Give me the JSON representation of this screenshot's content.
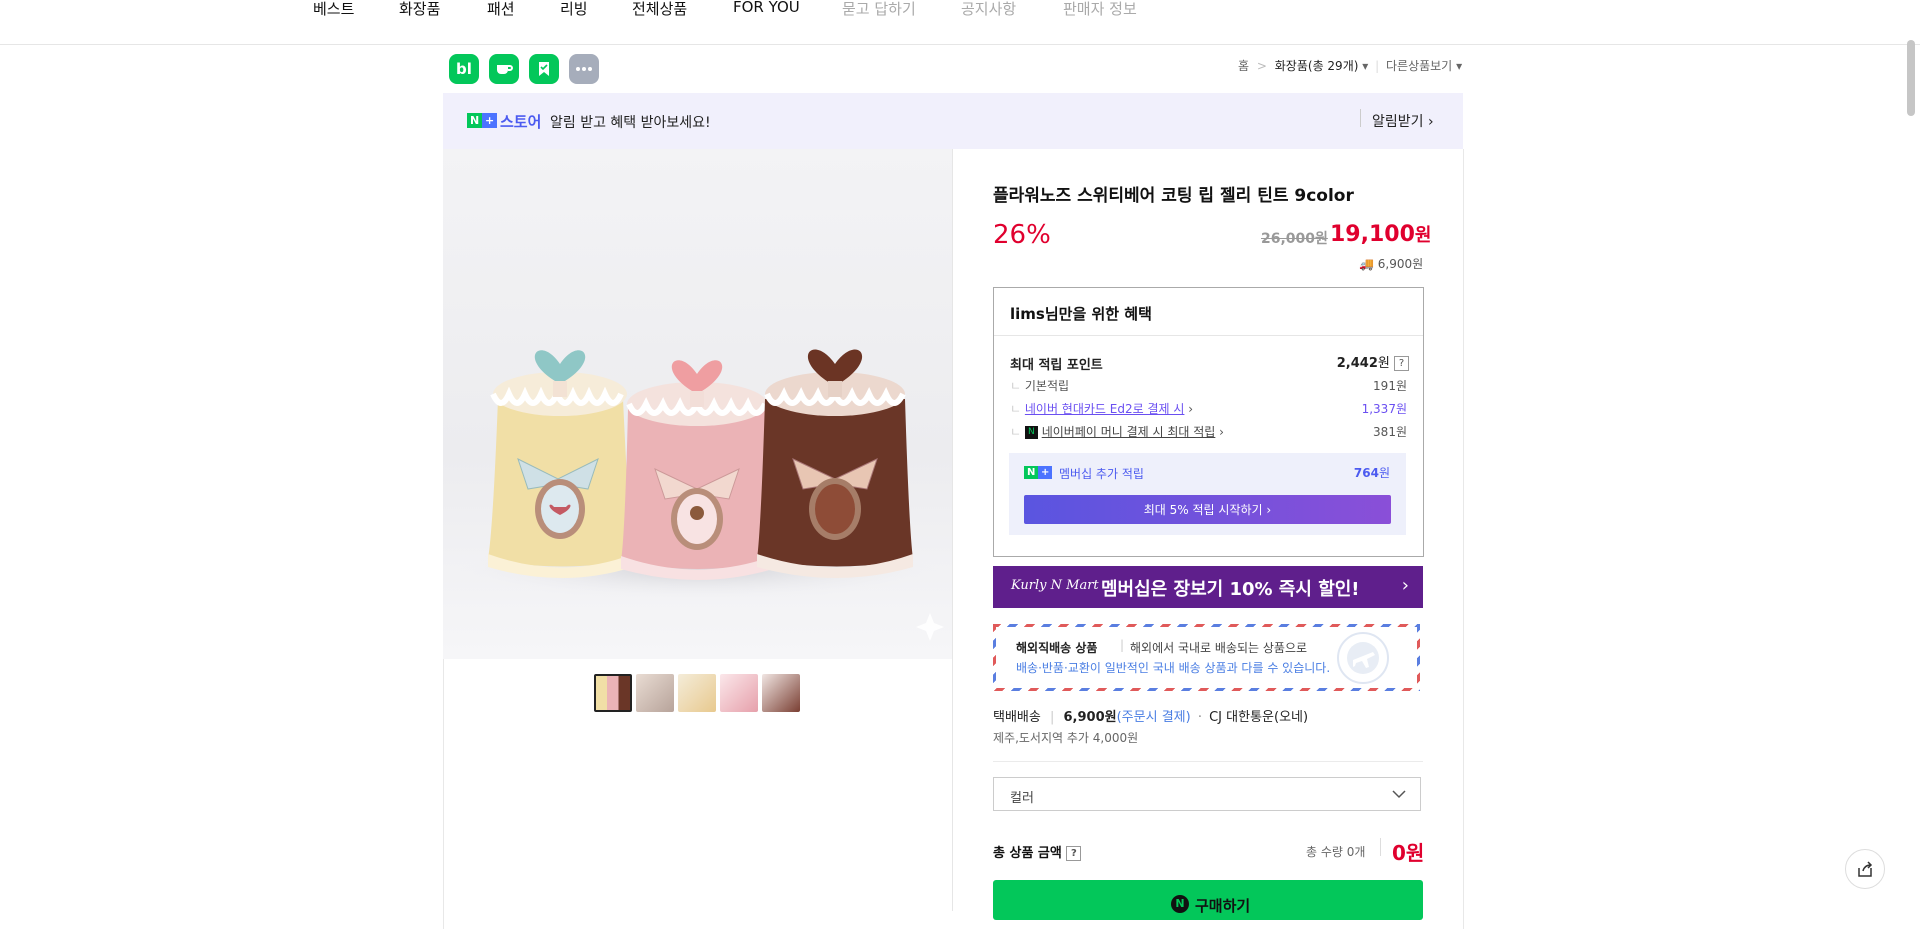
{
  "nav": {
    "items": [
      "베스트",
      "화장품",
      "패션",
      "리빙",
      "전체상품",
      "FOR YOU"
    ],
    "dim_items": [
      "묻고 답하기",
      "공지사항",
      "판매자 정보"
    ]
  },
  "share": {
    "icons": [
      "blog-icon",
      "cafe-icon",
      "bookmark-icon",
      "more-icon"
    ],
    "blog_label": "bl"
  },
  "breadcrumb": {
    "home": "홈",
    "separator": ">",
    "category": "화장품(총 29개)",
    "other": "다른상품보기"
  },
  "banner": {
    "logo_n": "N",
    "logo_store": "스토어",
    "text": "알림 받고 혜택 받아보세요!",
    "action": "알림받기"
  },
  "product": {
    "title": "플라워노즈 스위티베어 코팅 립 젤리 틴트 9color",
    "discount": "26%",
    "original_price": "26,000원",
    "sale_price": "19,100",
    "sale_unit": "원",
    "shipping_fee": "6,900원"
  },
  "benefit": {
    "heading": "lims님만을 위한 혜택",
    "max_points_label": "최대 적립 포인트",
    "max_points_value": "2,442",
    "unit": "원",
    "rows": [
      {
        "label": "기본적립",
        "value": "191원"
      },
      {
        "label": "네이버 현대카드 Ed2로 결제 시",
        "value": "1,337원"
      },
      {
        "label": "네이버페이 머니 결제 시 최대 적립",
        "value": "381원"
      }
    ],
    "membership_label": "멤버십 추가 적립",
    "membership_value": "764",
    "membership_button": "최대 5% 적립 시작하기"
  },
  "kurly": {
    "logo": "Kurly N Mart",
    "text": "멤버십은 장보기 10% 즉시 할인!"
  },
  "overseas": {
    "title": "해외직배송 상품",
    "desc": "해외에서 국내로 배송되는 상품으로",
    "note": "배송·반품·교환이 일반적인 국내 배송 상품과 다를 수 있습니다."
  },
  "delivery": {
    "type": "택배배송",
    "fee": "6,900원",
    "pay": "(주문시 결제)",
    "carrier": "CJ 대한통운(오네)",
    "extra": "제주,도서지역 추가 4,000원"
  },
  "option": {
    "placeholder": "컬러"
  },
  "total": {
    "label": "총 상품 금액",
    "qty": "총 수량 0개",
    "amount": "0원"
  },
  "buy": {
    "label": "구매하기"
  },
  "colors": {
    "naver_green": "#03c75a",
    "sale_red": "#e0002e",
    "purple": "#6a4ff1"
  }
}
